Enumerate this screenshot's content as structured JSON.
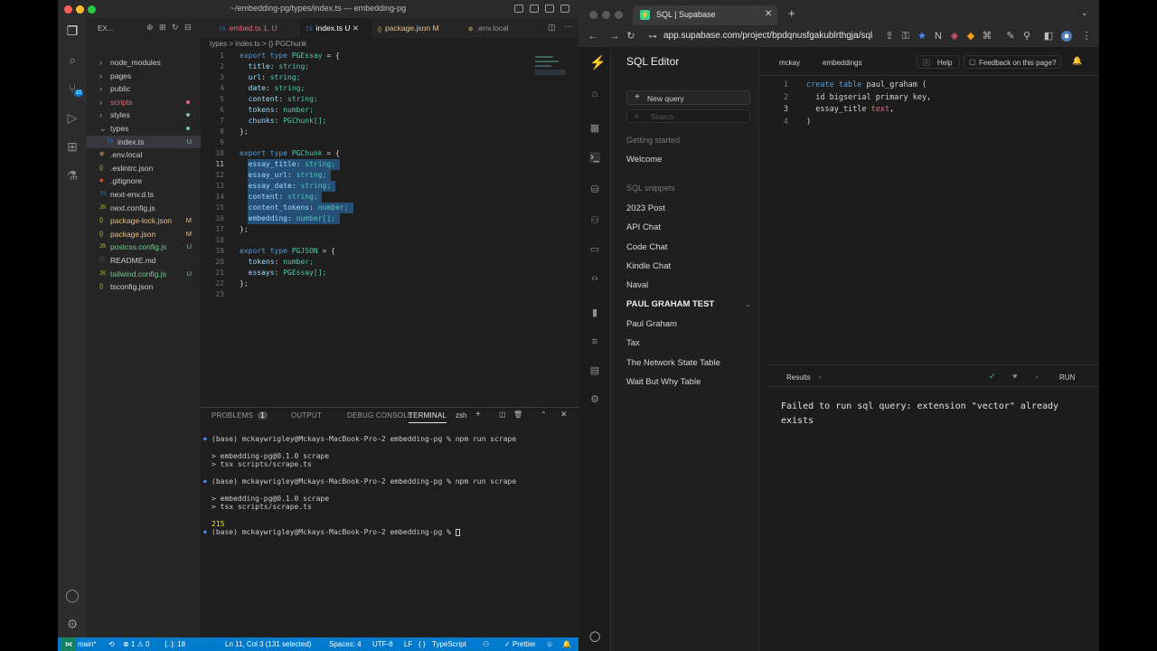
{
  "vscode": {
    "title": "~/embedding-pg/types/index.ts — embedding-pg",
    "explorer_label": "EX...",
    "files": [
      {
        "name": "node_modules",
        "type": "folder",
        "indent": 0,
        "color": "#cccccc",
        "status": ""
      },
      {
        "name": "pages",
        "type": "folder",
        "indent": 0,
        "color": "#cccccc",
        "status": ""
      },
      {
        "name": "public",
        "type": "folder",
        "indent": 0,
        "color": "#cccccc",
        "status": ""
      },
      {
        "name": "scripts",
        "type": "folder",
        "indent": 0,
        "color": "#e06c75",
        "status": "dot"
      },
      {
        "name": "styles",
        "type": "folder",
        "indent": 0,
        "color": "#cccccc",
        "status": "dot"
      },
      {
        "name": "types",
        "type": "folder-open",
        "indent": 0,
        "color": "#cccccc",
        "status": "dot"
      },
      {
        "name": "index.ts",
        "type": "ts",
        "indent": 1,
        "color": "#cccccc",
        "status": "U",
        "selected": true
      },
      {
        "name": ".env.local",
        "type": "env",
        "indent": 0,
        "color": "#cccccc",
        "status": ""
      },
      {
        "name": ".eslintrc.json",
        "type": "json",
        "indent": 0,
        "color": "#cccccc",
        "status": ""
      },
      {
        "name": ".gitignore",
        "type": "git",
        "indent": 0,
        "color": "#cccccc",
        "status": ""
      },
      {
        "name": "next-env.d.ts",
        "type": "ts",
        "indent": 0,
        "color": "#cccccc",
        "status": ""
      },
      {
        "name": "next.config.js",
        "type": "js",
        "indent": 0,
        "color": "#cccccc",
        "status": ""
      },
      {
        "name": "package-lock.json",
        "type": "json",
        "indent": 0,
        "color": "#e2c08d",
        "status": "M"
      },
      {
        "name": "package.json",
        "type": "json",
        "indent": 0,
        "color": "#e2c08d",
        "status": "M"
      },
      {
        "name": "postcss.config.js",
        "type": "js",
        "indent": 0,
        "color": "#73c991",
        "status": "U"
      },
      {
        "name": "README.md",
        "type": "md",
        "indent": 0,
        "color": "#cccccc",
        "status": ""
      },
      {
        "name": "tailwind.config.js",
        "type": "js",
        "indent": 0,
        "color": "#73c991",
        "status": "U"
      },
      {
        "name": "tsconfig.json",
        "type": "json",
        "indent": 0,
        "color": "#cccccc",
        "status": ""
      }
    ],
    "tabs": [
      {
        "label": "embed.ts  1, U",
        "color": "#e06c75",
        "active": false
      },
      {
        "label": "index.ts  U",
        "color": "#ffffff",
        "active": true
      },
      {
        "label": "package.json  M",
        "color": "#e2c08d",
        "active": false
      },
      {
        "label": ".env.local",
        "color": "#9a9a9a",
        "active": false
      }
    ],
    "breadcrumb": "types > index.ts > {} PGChunk",
    "code": [
      "export type PGEssay = {",
      "  title: string;",
      "  url: string;",
      "  date: string;",
      "  content: string;",
      "  tokens: number;",
      "  chunks: PGChunk[];",
      "};",
      "",
      "export type PGChunk = {",
      "  essay_title: string;",
      "  essay_url: string;",
      "  essay_date: string;",
      "  content: string;",
      "  content_tokens: number;",
      "  embedding: number[];",
      "};",
      "",
      "export type PGJSON = {",
      "  tokens: number;",
      "  essays: PGEssay[];",
      "};",
      ""
    ],
    "panel_tabs": [
      "PROBLEMS",
      "1",
      "OUTPUT",
      "DEBUG CONSOLE",
      "TERMINAL"
    ],
    "shell": "zsh",
    "terminal": [
      "(base) mckaywrigley@Mckays-MacBook-Pro-2 embedding-pg % npm run scrape",
      "",
      "> embedding-pg@0.1.0 scrape",
      "> tsx scripts/scrape.ts",
      "",
      "(base) mckaywrigley@Mckays-MacBook-Pro-2 embedding-pg % npm run scrape",
      "",
      "> embedding-pg@0.1.0 scrape",
      "> tsx scripts/scrape.ts",
      "",
      "215",
      "(base) mckaywrigley@Mckays-MacBook-Pro-2 embedding-pg % "
    ],
    "status": {
      "branch": "main*",
      "errors": "⊗ 1 ⚠ 0",
      "braces": "{..}: 18",
      "cursor": "Ln 11, Col 3 (131 selected)",
      "spaces": "Spaces: 4",
      "encoding": "UTF-8",
      "eol": "LF",
      "language": "TypeScript",
      "prettier": "✓ Prettier"
    }
  },
  "browser": {
    "tab_title": "SQL | Supabase",
    "url": "app.supabase.com/project/bpdqnusfgakublrthgja/sql",
    "app_title": "SQL Editor",
    "new_query": "New query",
    "search_placeholder": "Search",
    "getting_started": "Getting started",
    "welcome": "Welcome",
    "snippets_head": "SQL snippets",
    "snippets": [
      "2023 Post",
      "API Chat",
      "Code Chat",
      "Kindle Chat",
      "Naval"
    ],
    "active_snippet": "PAUL GRAHAM TEST",
    "snippets2": [
      "Paul Graham",
      "Tax",
      "The Network State Table",
      "Wait But Why Table"
    ],
    "breadcrumb": [
      "mckay",
      "embeddings"
    ],
    "help": "Help",
    "feedback": "Feedback on this page?",
    "sql_lines": [
      {
        "n": "1",
        "parts": [
          [
            "create table ",
            "#569cd6"
          ],
          [
            "paul_graham (",
            "#d4d4d4"
          ]
        ]
      },
      {
        "n": "2",
        "parts": [
          [
            "  id ",
            "#d4d4d4"
          ],
          [
            "bigserial primary key",
            "#d4d4d4"
          ],
          [
            ",",
            "#d4d4d4"
          ]
        ]
      },
      {
        "n": "3",
        "parts": [
          [
            "  essay_title ",
            "#d4d4d4"
          ],
          [
            "text",
            "#e06c75"
          ],
          [
            ",",
            "#d4d4d4"
          ]
        ]
      },
      {
        "n": "4",
        "parts": [
          [
            ")",
            "#d4d4d4"
          ]
        ]
      }
    ],
    "results_label": "Results",
    "run_label": "RUN",
    "error_message": "Failed to run sql query: extension \"vector\" already exists"
  }
}
